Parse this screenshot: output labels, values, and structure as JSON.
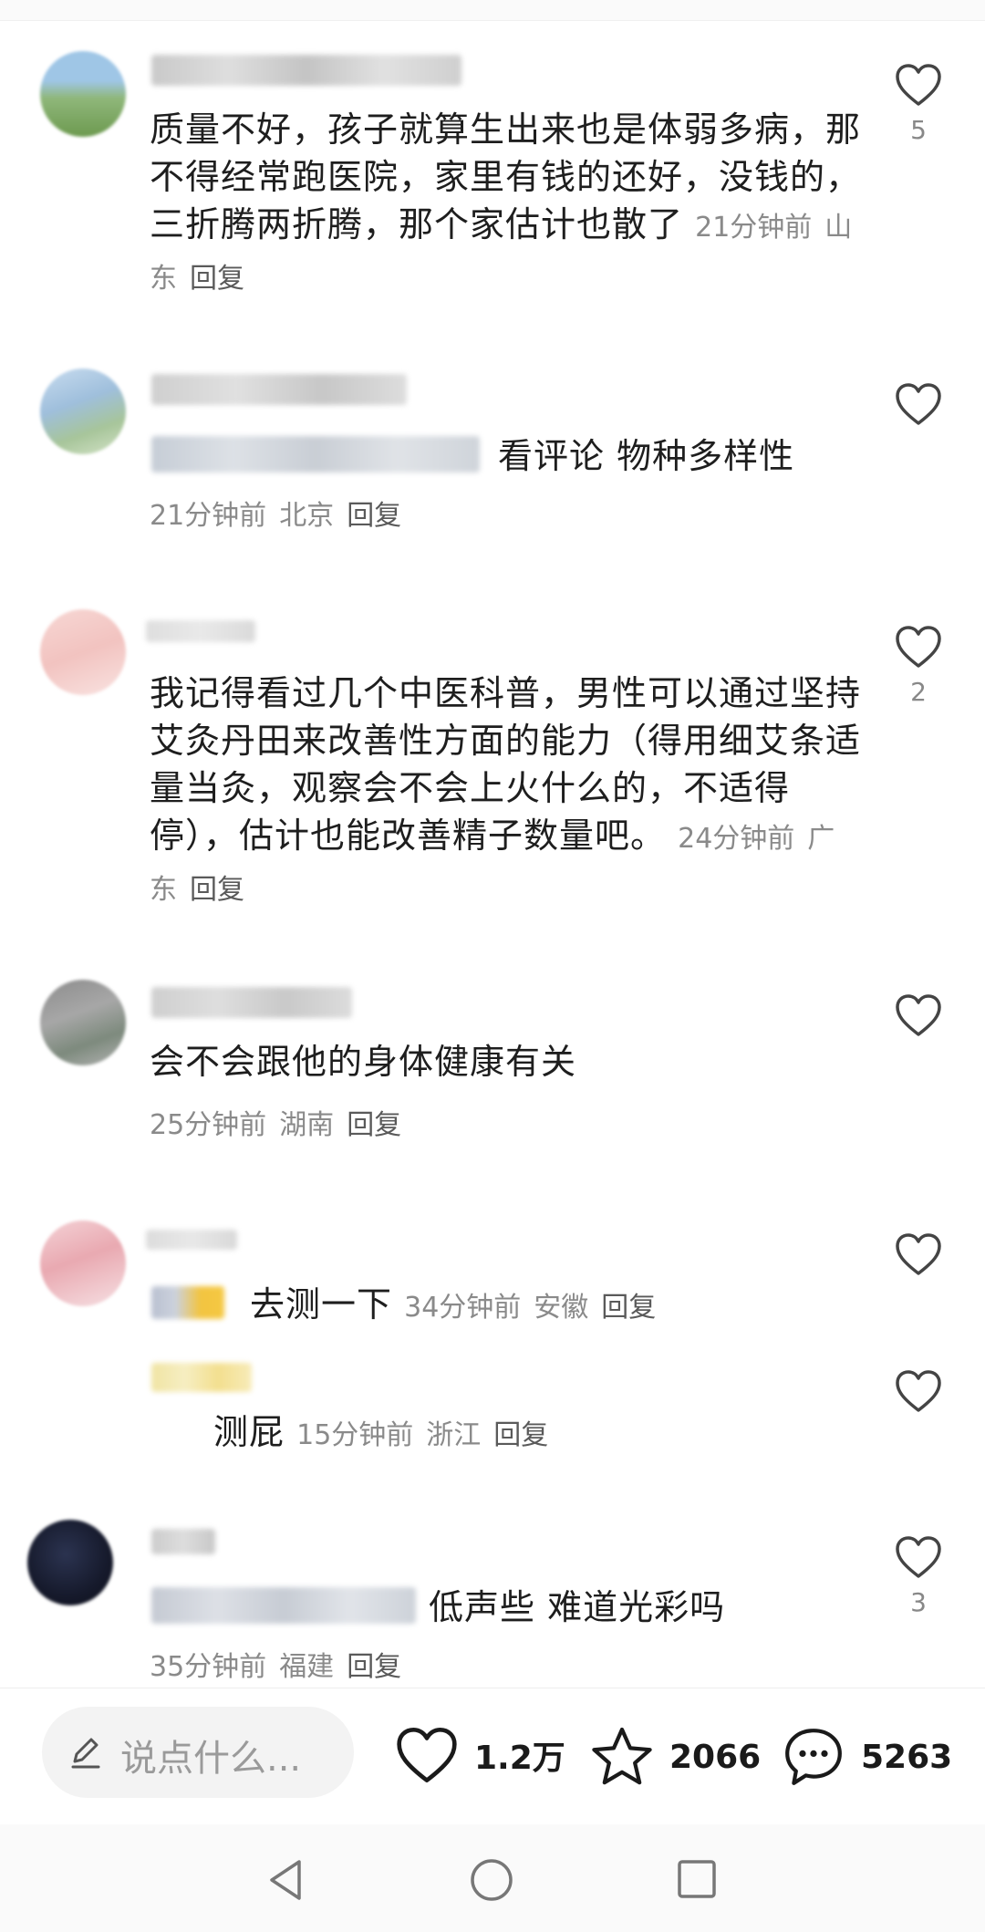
{
  "comments": [
    {
      "text": "质量不好，孩子就算生出来也是体弱多病，那不得经常跑医院，家里有钱的还好，没钱的，三折腾两折腾，那个家估计也散了",
      "time": "21分钟前",
      "location": "山东",
      "reply": "回复",
      "likes": "5"
    },
    {
      "text": "看评论 物种多样性",
      "time": "21分钟前",
      "location": "北京",
      "reply": "回复",
      "likes": ""
    },
    {
      "text": "我记得看过几个中医科普，男性可以通过坚持艾灸丹田来改善性方面的能力（得用细艾条适量当灸，观察会不会上火什么的，不适得停），估计也能改善精子数量吧。",
      "time": "24分钟前",
      "location": "广东",
      "reply": "回复",
      "likes": "2"
    },
    {
      "text": "会不会跟他的身体健康有关",
      "time": "25分钟前",
      "location": "湖南",
      "reply": "回复",
      "likes": ""
    },
    {
      "text": "去测一下",
      "time": "34分钟前",
      "location": "安徽",
      "reply": "回复",
      "likes": ""
    },
    {
      "text": "测屁",
      "time": "15分钟前",
      "location": "浙江",
      "reply": "回复",
      "likes": ""
    },
    {
      "text": "低声些 难道光彩吗",
      "time": "35分钟前",
      "location": "福建",
      "reply": "回复",
      "likes": "3"
    }
  ],
  "bottom": {
    "placeholder": "说点什么...",
    "likes": "1.2万",
    "favorites": "2066",
    "comments": "5263"
  },
  "icons": [
    "heart-icon",
    "star-icon",
    "chat-bubble-icon",
    "pencil-icon",
    "back-triangle-icon",
    "home-circle-icon",
    "recents-square-icon"
  ]
}
